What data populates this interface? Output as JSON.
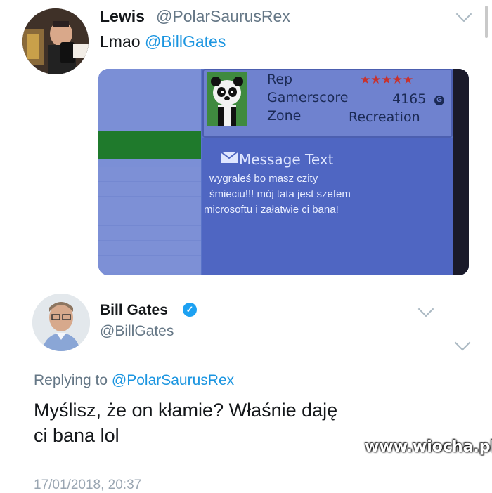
{
  "tweet1": {
    "name": "Lewis",
    "handle": "@PolarSaurusRex",
    "text_prefix": "Lmao ",
    "mention": "@BillGates"
  },
  "photo": {
    "rep_label": "Rep",
    "stars": "★★★★★",
    "gamerscore_label": "Gamerscore",
    "gamerscore_value": "4165",
    "gamerscore_icon": "G",
    "zone_label": "Zone",
    "zone_value": "Recreation",
    "message_title": "Message Text",
    "message_line1": "wygrałeś bo masz czity",
    "message_line2": "śmieciu!!! mój tata jest szefem",
    "message_line3": "microsoftu i załatwie ci bana!"
  },
  "tweet2": {
    "name": "Bill Gates",
    "verified_mark": "✓",
    "handle": "@BillGates",
    "replying_prefix": "Replying to ",
    "replying_to": "@PolarSaurusRex",
    "text_line1": "Myślisz, że on kłamie? Właśnie daję",
    "text_line2": "ci bana lol",
    "timestamp": "17/01/2018, 20:37"
  },
  "watermark": "www.wiocha.pl",
  "icons": {
    "chevron": "chevron-down-icon",
    "verified": "verified-badge-icon",
    "envelope": "envelope-icon",
    "gamerscore": "gamerscore-icon"
  },
  "colors": {
    "link": "#1b95e0",
    "verified": "#1da1f2",
    "muted": "#657786"
  }
}
